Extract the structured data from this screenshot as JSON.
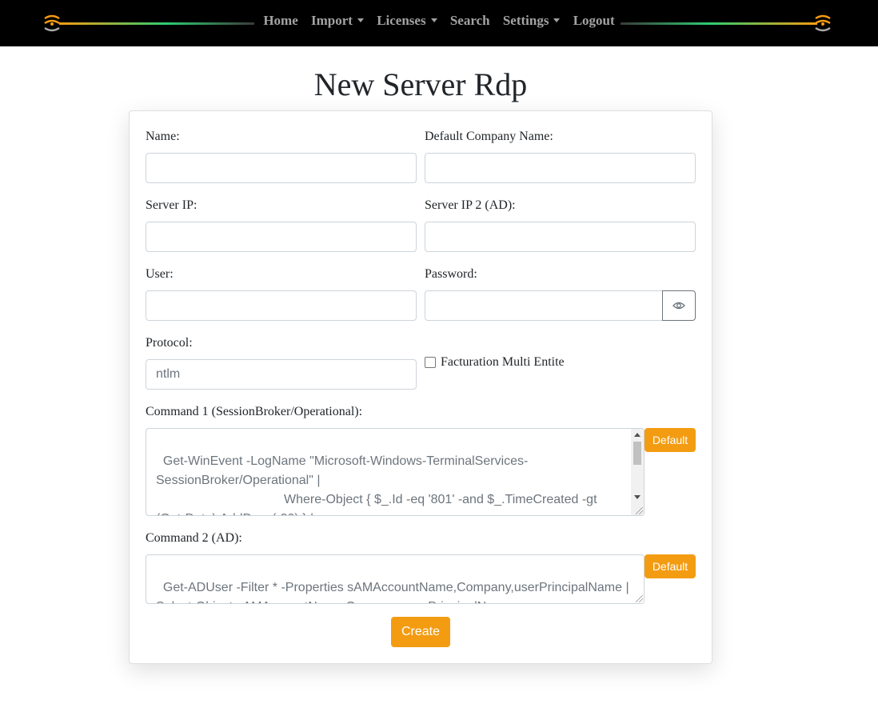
{
  "nav": {
    "items": [
      {
        "label": "Home",
        "dropdown": false
      },
      {
        "label": "Import",
        "dropdown": true
      },
      {
        "label": "Licenses",
        "dropdown": true
      },
      {
        "label": "Search",
        "dropdown": false
      },
      {
        "label": "Settings",
        "dropdown": true
      },
      {
        "label": "Logout",
        "dropdown": false
      }
    ],
    "logo_icon": "signal-wave-icon"
  },
  "page": {
    "title": "New Server Rdp"
  },
  "form": {
    "name": {
      "label": "Name:",
      "value": ""
    },
    "default_company": {
      "label": "Default Company Name:",
      "value": ""
    },
    "server_ip": {
      "label": "Server IP:",
      "value": ""
    },
    "server_ip2": {
      "label": "Server IP 2 (AD):",
      "value": ""
    },
    "user": {
      "label": "User:",
      "value": ""
    },
    "password": {
      "label": "Password:",
      "value": "",
      "toggle_icon": "eye-icon"
    },
    "protocol": {
      "label": "Protocol:",
      "placeholder": "ntlm"
    },
    "multi_entite": {
      "label": "Facturation Multi Entite",
      "checked": false
    },
    "command1": {
      "label": "Command 1 (SessionBroker/Operational):",
      "value": "Get-WinEvent -LogName \"Microsoft-Windows-TerminalServices-SessionBroker/Operational\" |\n                                    Where-Object { $_.Id -eq '801' -and $_.TimeCreated -gt (Get-Date).AddDays(-30) } |\n                                    Select-Object TimeCreated, Id, LevelDisplayName",
      "default_label": "Default"
    },
    "command2": {
      "label": "Command 2 (AD):",
      "value": "Get-ADUser -Filter * -Properties sAMAccountName,Company,userPrincipalName | Select-Object sAMAccountName,Company,userPrincipalName",
      "default_label": "Default"
    },
    "create_label": "Create"
  },
  "colors": {
    "accent": "#f39c12",
    "navbar": "#000000",
    "nav_text": "#a3a3a3"
  }
}
